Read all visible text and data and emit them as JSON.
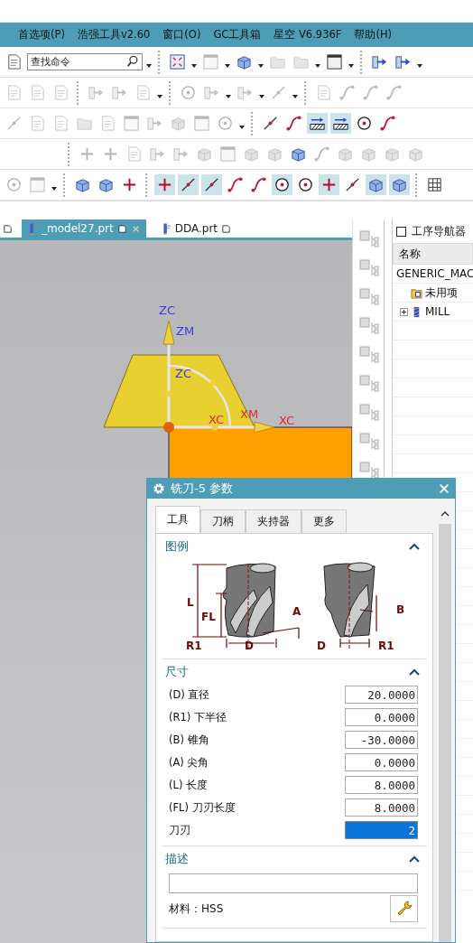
{
  "menu": [
    "首选项(P)",
    "浩强工具v2.60",
    "窗口(O)",
    "GC工具箱",
    "星空 V6.936F",
    "帮助(H)"
  ],
  "search": {
    "placeholder": "查找命令"
  },
  "toolbars": [
    {
      "indented": false,
      "groups": [
        [
          {
            "kind": "document",
            "disabled": false,
            "pressed": false
          },
          {
            "kind": "search",
            "disabled": false,
            "pressed": false
          },
          {
            "kind": "caret",
            "disabled": false,
            "pressed": false
          }
        ],
        [
          {
            "kind": "frame",
            "disabled": false,
            "pressed": false
          },
          {
            "kind": "caret",
            "disabled": false,
            "pressed": false
          },
          {
            "kind": "window",
            "disabled": true,
            "pressed": false
          },
          {
            "kind": "caret",
            "disabled": false,
            "pressed": false
          },
          {
            "kind": "cube",
            "disabled": false,
            "pressed": false
          },
          {
            "kind": "caret",
            "disabled": false,
            "pressed": false
          },
          {
            "kind": "folder",
            "disabled": true,
            "pressed": false
          },
          {
            "kind": "folder",
            "disabled": true,
            "pressed": false
          },
          {
            "kind": "caret",
            "disabled": false,
            "pressed": false
          },
          {
            "kind": "window",
            "disabled": false,
            "pressed": false
          },
          {
            "kind": "caret",
            "disabled": false,
            "pressed": false
          }
        ],
        [
          {
            "kind": "arrow",
            "disabled": false,
            "pressed": false
          },
          {
            "kind": "arrow",
            "disabled": false,
            "pressed": false
          },
          {
            "kind": "caret",
            "disabled": false,
            "pressed": false
          }
        ]
      ]
    },
    {
      "indented": false,
      "groups": [
        [
          {
            "kind": "document",
            "disabled": true,
            "pressed": false
          },
          {
            "kind": "document",
            "disabled": true,
            "pressed": false
          },
          {
            "kind": "document",
            "disabled": true,
            "pressed": false
          }
        ],
        [
          {
            "kind": "arrow",
            "disabled": true,
            "pressed": false
          },
          {
            "kind": "arrow",
            "disabled": true,
            "pressed": false
          },
          {
            "kind": "document",
            "disabled": true,
            "pressed": false
          },
          {
            "kind": "caret",
            "disabled": false,
            "pressed": false
          }
        ],
        [
          {
            "kind": "target",
            "disabled": true,
            "pressed": false
          },
          {
            "kind": "arrow",
            "disabled": true,
            "pressed": false
          },
          {
            "kind": "caret",
            "disabled": false,
            "pressed": false
          },
          {
            "kind": "arrow",
            "disabled": true,
            "pressed": false
          },
          {
            "kind": "caret",
            "disabled": false,
            "pressed": false
          },
          {
            "kind": "line",
            "disabled": true,
            "pressed": false
          },
          {
            "kind": "caret",
            "disabled": false,
            "pressed": false
          }
        ],
        [
          {
            "kind": "document",
            "disabled": true,
            "pressed": false
          },
          {
            "kind": "curve",
            "disabled": true,
            "pressed": false
          },
          {
            "kind": "curve",
            "disabled": true,
            "pressed": false
          },
          {
            "kind": "curve",
            "disabled": true,
            "pressed": false
          }
        ]
      ]
    },
    {
      "indented": false,
      "groups": [
        [
          {
            "kind": "line",
            "disabled": true,
            "pressed": false
          },
          {
            "kind": "document",
            "disabled": true,
            "pressed": false
          },
          {
            "kind": "document",
            "disabled": true,
            "pressed": false
          },
          {
            "kind": "folder",
            "disabled": true,
            "pressed": false
          },
          {
            "kind": "document",
            "disabled": true,
            "pressed": false
          },
          {
            "kind": "window",
            "disabled": true,
            "pressed": false
          },
          {
            "kind": "arrow",
            "disabled": true,
            "pressed": false
          },
          {
            "kind": "cube",
            "disabled": true,
            "pressed": false
          },
          {
            "kind": "window",
            "disabled": true,
            "pressed": false
          },
          {
            "kind": "target",
            "disabled": true,
            "pressed": false
          },
          {
            "kind": "caret",
            "disabled": false,
            "pressed": false
          }
        ],
        [
          {
            "kind": "line",
            "disabled": false,
            "pressed": false
          },
          {
            "kind": "curve",
            "disabled": false,
            "pressed": false
          },
          {
            "kind": "hatch",
            "disabled": false,
            "pressed": true
          },
          {
            "kind": "hatch",
            "disabled": false,
            "pressed": true
          },
          {
            "kind": "target",
            "disabled": false,
            "pressed": false
          },
          {
            "kind": "curve",
            "disabled": false,
            "pressed": false
          }
        ]
      ]
    },
    {
      "indented": true,
      "groups": [
        [
          {
            "kind": "cross",
            "disabled": true,
            "pressed": false
          },
          {
            "kind": "cross",
            "disabled": true,
            "pressed": false
          },
          {
            "kind": "document",
            "disabled": true,
            "pressed": false
          },
          {
            "kind": "arrow",
            "disabled": true,
            "pressed": false
          },
          {
            "kind": "arrow",
            "disabled": true,
            "pressed": false
          },
          {
            "kind": "cube",
            "disabled": true,
            "pressed": false
          },
          {
            "kind": "window",
            "disabled": true,
            "pressed": false
          },
          {
            "kind": "cube",
            "disabled": true,
            "pressed": false
          },
          {
            "kind": "cube",
            "disabled": true,
            "pressed": false
          },
          {
            "kind": "cube",
            "disabled": false,
            "pressed": false
          },
          {
            "kind": "curve",
            "disabled": true,
            "pressed": false
          },
          {
            "kind": "cube",
            "disabled": true,
            "pressed": false
          },
          {
            "kind": "cube",
            "disabled": true,
            "pressed": false
          },
          {
            "kind": "cube",
            "disabled": true,
            "pressed": false
          },
          {
            "kind": "cube",
            "disabled": true,
            "pressed": false
          }
        ]
      ]
    },
    {
      "indented": false,
      "groups": [
        [
          {
            "kind": "target",
            "disabled": true,
            "pressed": false
          },
          {
            "kind": "window",
            "disabled": true,
            "pressed": false
          },
          {
            "kind": "caret",
            "disabled": false,
            "pressed": false
          }
        ],
        [
          {
            "kind": "cube",
            "disabled": false,
            "pressed": false
          },
          {
            "kind": "cube",
            "disabled": false,
            "pressed": false
          },
          {
            "kind": "cross",
            "disabled": false,
            "pressed": false
          }
        ],
        [
          {
            "kind": "cross",
            "disabled": false,
            "pressed": true
          },
          {
            "kind": "line",
            "disabled": false,
            "pressed": true
          },
          {
            "kind": "line",
            "disabled": false,
            "pressed": true
          },
          {
            "kind": "curve",
            "disabled": false,
            "pressed": false
          },
          {
            "kind": "curve",
            "disabled": false,
            "pressed": false
          },
          {
            "kind": "target",
            "disabled": false,
            "pressed": true
          },
          {
            "kind": "target",
            "disabled": false,
            "pressed": false
          },
          {
            "kind": "cross",
            "disabled": false,
            "pressed": true
          },
          {
            "kind": "line",
            "disabled": false,
            "pressed": false
          },
          {
            "kind": "cube",
            "disabled": false,
            "pressed": true
          },
          {
            "kind": "cube",
            "disabled": false,
            "pressed": true
          }
        ],
        [
          {
            "kind": "grid",
            "disabled": false,
            "pressed": false
          }
        ]
      ]
    }
  ],
  "file_tabs": [
    {
      "label": "_model27.prt",
      "selected": true
    },
    {
      "label": "DDA.prt",
      "selected": false
    }
  ],
  "viewport": {
    "axis_labels": [
      {
        "text": "ZC",
        "kind": "z"
      },
      {
        "text": "ZM",
        "kind": "z"
      },
      {
        "text": "ZC",
        "kind": "z"
      },
      {
        "text": "XC",
        "kind": "x"
      },
      {
        "text": "XM",
        "kind": "x"
      },
      {
        "text": "XC",
        "kind": "x"
      }
    ]
  },
  "navigator": {
    "title": "工序导航器",
    "checked": false,
    "column": "名称",
    "tree": [
      {
        "label": "GENERIC_MAC",
        "children": [
          {
            "label": "未用项",
            "kind": "folder"
          },
          {
            "label": "MILL",
            "kind": "tool",
            "expanded": false
          }
        ]
      }
    ]
  },
  "dialog": {
    "title": "铣刀-5 参数",
    "tabs": [
      {
        "label": "工具",
        "selected": true
      },
      {
        "label": "刀柄",
        "selected": false
      },
      {
        "label": "夹持器",
        "selected": false
      },
      {
        "label": "更多",
        "selected": false
      }
    ],
    "sections": [
      {
        "kind": "legend",
        "title": "图例",
        "expanded": true,
        "labels_left": [
          "L",
          "FL",
          "A",
          "R1",
          "D"
        ],
        "labels_right": [
          "B",
          "D",
          "R1"
        ]
      },
      {
        "kind": "fields",
        "title": "尺寸",
        "expanded": true,
        "fields": [
          {
            "label": "(D) 直径",
            "value": "20.0000",
            "selected": false
          },
          {
            "label": "(R1) 下半径",
            "value": "0.0000",
            "selected": false
          },
          {
            "label": "(B) 锥角",
            "value": "-30.0000",
            "selected": false
          },
          {
            "label": "(A) 尖角",
            "value": "0.0000",
            "selected": false
          },
          {
            "label": "(L) 长度",
            "value": "8.0000",
            "selected": false
          },
          {
            "label": "(FL) 刀刃长度",
            "value": "8.0000",
            "selected": false
          },
          {
            "label": "刀刃",
            "value": "2",
            "selected": true
          }
        ]
      },
      {
        "kind": "description",
        "title": "描述",
        "expanded": true,
        "material": "材料：HSS"
      }
    ]
  }
}
